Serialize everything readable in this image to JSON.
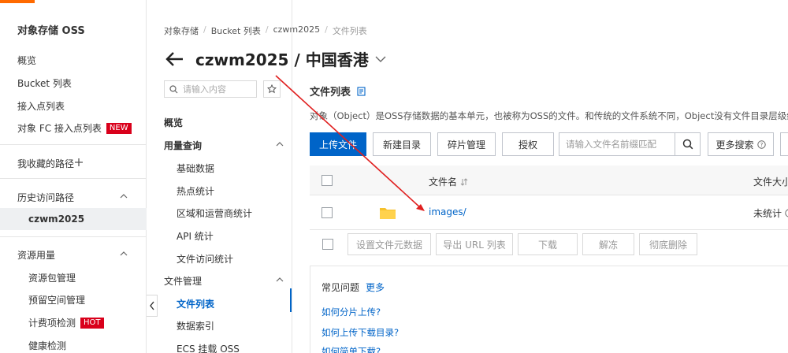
{
  "left_nav": {
    "title": "对象存储 OSS",
    "items": [
      {
        "label": "概览"
      },
      {
        "label": "Bucket 列表"
      },
      {
        "label": "接入点列表"
      },
      {
        "label": "对象 FC 接入点列表",
        "badge": "NEW"
      }
    ],
    "favorites_label": "我收藏的路径",
    "history_label": "历史访问路径",
    "history_item": "czwm2025",
    "resource_label": "资源用量",
    "resource_items": [
      {
        "label": "资源包管理"
      },
      {
        "label": "预留空间管理"
      },
      {
        "label": "计费项检测",
        "badge": "HOT"
      },
      {
        "label": "健康检测"
      }
    ],
    "accent_color": "#ff6a00",
    "badge_color": "#d9001b"
  },
  "breadcrumb": [
    "对象存储",
    "Bucket 列表",
    "czwm2025",
    "文件列表"
  ],
  "bucket_title": "czwm2025 / 中国香港",
  "sub_nav": {
    "search_placeholder": "请输入内容",
    "overview": "概览",
    "usage_group": "用量查询",
    "usage_items": [
      "基础数据",
      "热点统计",
      "区域和运营商统计",
      "API 统计",
      "文件访问统计"
    ],
    "file_group": "文件管理",
    "file_items": [
      "文件列表",
      "数据索引",
      "ECS 挂载 OSS"
    ],
    "active_item": "文件列表"
  },
  "main": {
    "title": "文件列表",
    "description": "对象（Object）是OSS存储数据的基本单元，也被称为OSS的文件。和传统的文件系统不同，Object没有文件目录层级结构的关系",
    "toolbar": {
      "upload": "上传文件",
      "new_dir": "新建目录",
      "fragments": "碎片管理",
      "authorize": "授权",
      "search_placeholder": "请输入文件名前缀匹配",
      "more_search": "更多搜索"
    },
    "table": {
      "col_name": "文件名",
      "col_size": "文件大小",
      "rows": [
        {
          "name": "images/",
          "size": "未统计"
        }
      ]
    },
    "batch_actions": [
      "设置文件元数据",
      "导出 URL 列表",
      "下载",
      "解冻",
      "彻底删除"
    ],
    "faq": {
      "title": "常见问题",
      "more": "更多",
      "links": [
        "如何分片上传?",
        "如何上传下载目录?",
        "如何简单下载?"
      ]
    },
    "primary_color": "#0064c8"
  },
  "annotation_color": "#e02020"
}
